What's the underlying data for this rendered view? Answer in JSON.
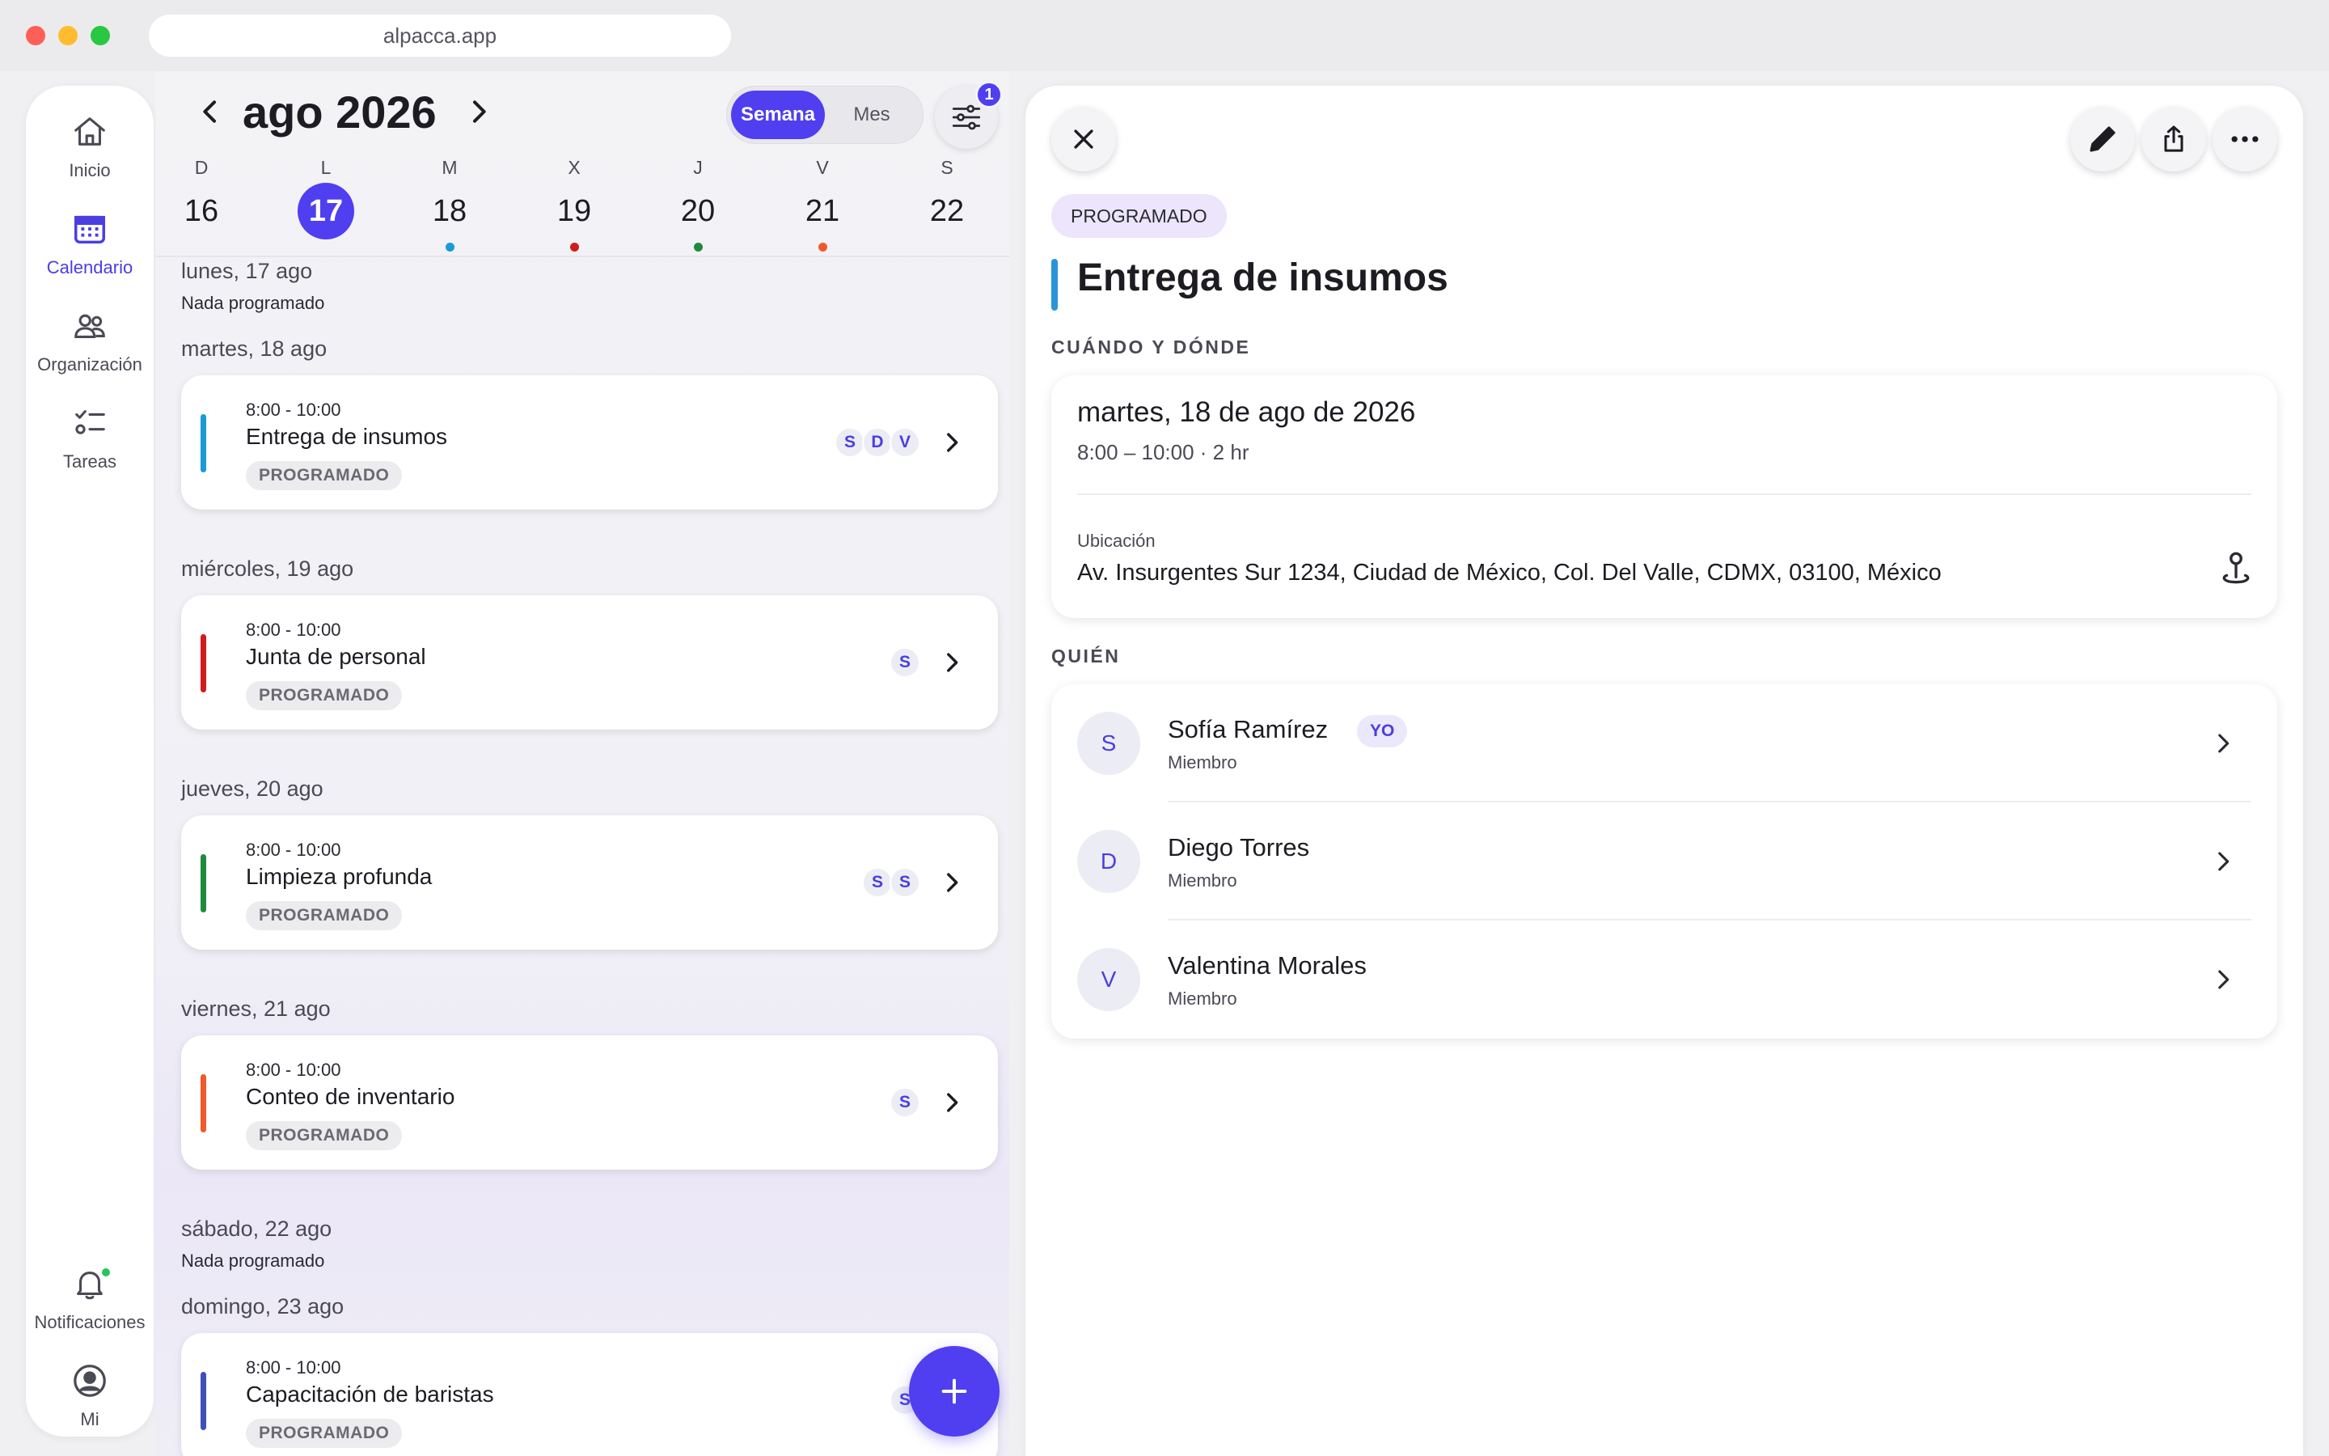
{
  "browser": {
    "url": "alpacca.app"
  },
  "sidebar": {
    "items": [
      {
        "label": "Inicio",
        "icon": "home-icon"
      },
      {
        "label": "Calendario",
        "icon": "calendar-icon",
        "active": true
      },
      {
        "label": "Organización",
        "icon": "people-icon"
      },
      {
        "label": "Tareas",
        "icon": "tasks-icon"
      }
    ],
    "bottom": [
      {
        "label": "Notificaciones",
        "icon": "bell-icon"
      },
      {
        "label": "Mi",
        "icon": "user-circle-icon"
      }
    ]
  },
  "calendar": {
    "month_title": "ago 2026",
    "view_toggle": {
      "week": "Semana",
      "month": "Mes",
      "active": "Semana"
    },
    "filter_count": "1",
    "week": [
      {
        "letter": "D",
        "day": "16"
      },
      {
        "letter": "L",
        "day": "17",
        "selected": true
      },
      {
        "letter": "M",
        "day": "18",
        "dot": "#1a9ad6"
      },
      {
        "letter": "X",
        "day": "19",
        "dot": "#d01c1c"
      },
      {
        "letter": "J",
        "day": "20",
        "dot": "#1f8a3e"
      },
      {
        "letter": "V",
        "day": "21",
        "dot": "#ef5a2a"
      },
      {
        "letter": "S",
        "day": "22"
      }
    ],
    "agenda": [
      {
        "date": "lunes, 17 ago",
        "empty_text": "Nada programado"
      },
      {
        "date": "martes, 18 ago",
        "events": [
          {
            "time": "8:00 - 10:00",
            "title": "Entrega de insumos",
            "status": "PROGRAMADO",
            "color": "#1a9ad6",
            "assignees": [
              "S",
              "D",
              "V"
            ]
          }
        ]
      },
      {
        "date": "miércoles, 19 ago",
        "events": [
          {
            "time": "8:00 - 10:00",
            "title": "Junta de personal",
            "status": "PROGRAMADO",
            "color": "#d01c1c",
            "assignees": [
              "S"
            ]
          }
        ]
      },
      {
        "date": "jueves, 20 ago",
        "events": [
          {
            "time": "8:00 - 10:00",
            "title": "Limpieza profunda",
            "status": "PROGRAMADO",
            "color": "#1f8a3e",
            "assignees": [
              "S",
              "S"
            ]
          }
        ]
      },
      {
        "date": "viernes, 21 ago",
        "events": [
          {
            "time": "8:00 - 10:00",
            "title": "Conteo de inventario",
            "status": "PROGRAMADO",
            "color": "#ef5a2a",
            "assignees": [
              "S"
            ]
          }
        ]
      },
      {
        "date": "sábado, 22 ago",
        "empty_text": "Nada programado"
      },
      {
        "date": "domingo, 23 ago",
        "events": [
          {
            "time": "8:00 - 10:00",
            "title": "Capacitación de baristas",
            "status": "PROGRAMADO",
            "color": "#3f4fb8",
            "assignees": [
              "S"
            ]
          }
        ]
      }
    ]
  },
  "detail": {
    "status": "PROGRAMADO",
    "title": "Entrega de insumos",
    "accent_color": "#2b95d8",
    "when_where_label": "CUÁNDO Y DÓNDE",
    "date": "martes, 18 de ago de 2026",
    "time": "8:00 – 10:00 · 2 hr",
    "location_label": "Ubicación",
    "location": "Av. Insurgentes Sur 1234, Ciudad de México, Col. Del Valle, CDMX, 03100, México",
    "who_label": "QUIÉN",
    "people": [
      {
        "initial": "S",
        "name": "Sofía Ramírez",
        "role": "Miembro",
        "badge": "YO"
      },
      {
        "initial": "D",
        "name": "Diego Torres",
        "role": "Miembro"
      },
      {
        "initial": "V",
        "name": "Valentina Morales",
        "role": "Miembro"
      }
    ]
  }
}
